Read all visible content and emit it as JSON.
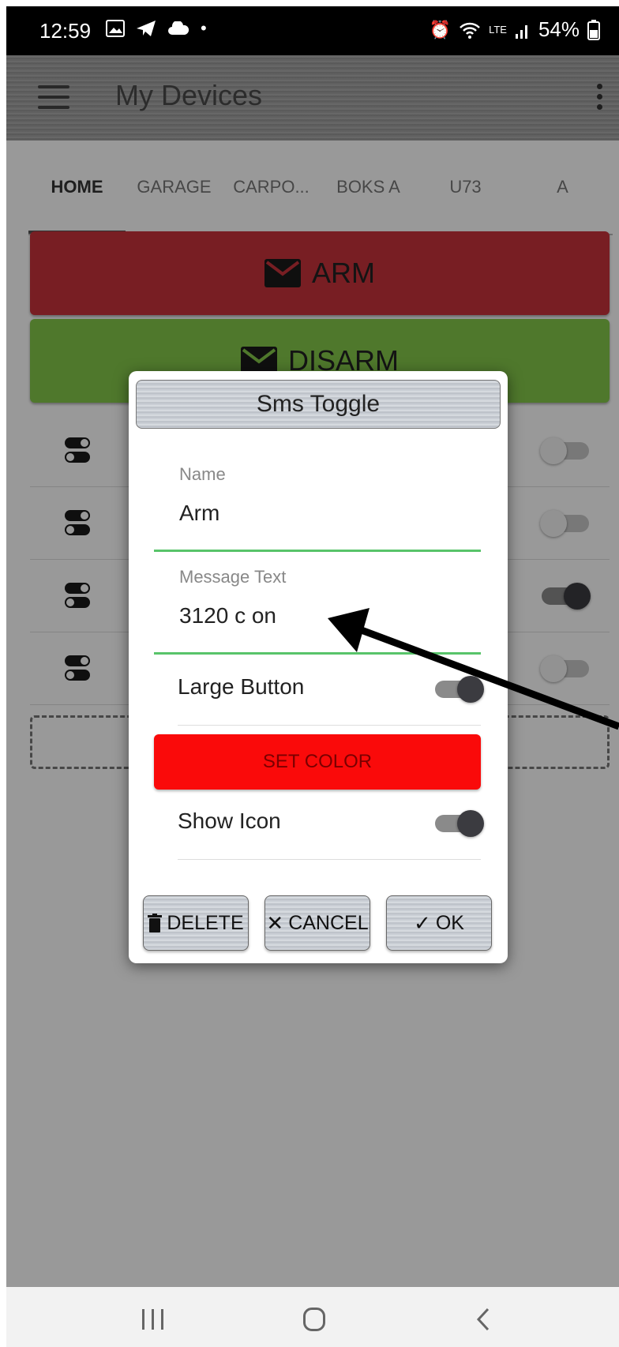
{
  "status_bar": {
    "time": "12:59",
    "battery": "54%",
    "network": "LTE"
  },
  "app_bar": {
    "title": "My Devices"
  },
  "tabs": [
    {
      "label": "HOME",
      "active": true
    },
    {
      "label": "GARAGE"
    },
    {
      "label": "CARPO..."
    },
    {
      "label": "BOKS A"
    },
    {
      "label": "U73"
    },
    {
      "label": "A"
    }
  ],
  "main": {
    "arm_label": "ARM",
    "disarm_label": "DISARM",
    "arm_color": "#c8323b",
    "disarm_color": "#84c84a",
    "rows": [
      {
        "toggle": "off"
      },
      {
        "toggle": "off"
      },
      {
        "toggle": "on"
      },
      {
        "toggle": "off"
      }
    ]
  },
  "dialog": {
    "title": "Sms Toggle",
    "name_label": "Name",
    "name_value": "Arm",
    "message_label": "Message Text",
    "message_value": "3120 c on",
    "large_button_label": "Large Button",
    "large_button_on": true,
    "set_color_label": "SET COLOR",
    "set_color": "#fa0a0a",
    "show_icon_label": "Show Icon",
    "show_icon_on": true,
    "delete_label": "DELETE",
    "cancel_label": "CANCEL",
    "ok_label": "OK",
    "accent_color": "#58c46a"
  }
}
